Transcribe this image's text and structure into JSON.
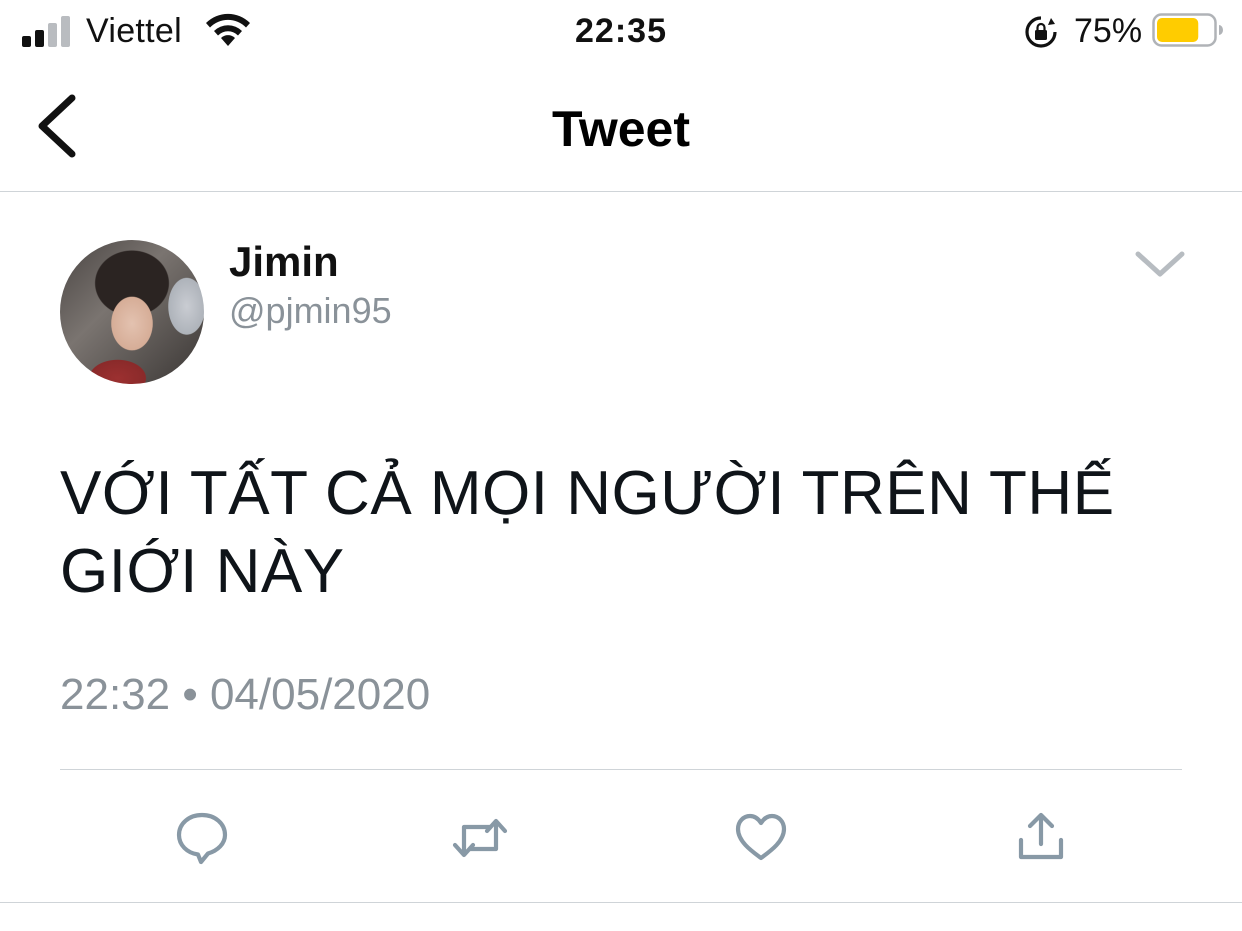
{
  "status_bar": {
    "carrier": "Viettel",
    "time": "22:35",
    "battery_percent": "75%",
    "battery_level": 0.75,
    "battery_color": "#ffcc00",
    "icons": [
      "signal-icon",
      "wifi-icon",
      "rotation-lock-icon",
      "battery-icon"
    ]
  },
  "nav": {
    "title": "Tweet",
    "back_icon": "chevron-left-icon"
  },
  "tweet": {
    "author": {
      "name": "Jimin",
      "handle": "@pjmin95"
    },
    "text": "VỚI TẤT CẢ MỌI NGƯỜI TRÊN THẾ GIỚI NÀY",
    "timestamp": "22:32 • 04/05/2020",
    "menu_icon": "chevron-down-icon"
  },
  "actions": [
    {
      "name": "reply",
      "icon": "reply-icon"
    },
    {
      "name": "retweet",
      "icon": "retweet-icon"
    },
    {
      "name": "like",
      "icon": "heart-icon"
    },
    {
      "name": "share",
      "icon": "share-icon"
    }
  ],
  "colors": {
    "text_primary": "#0f1419",
    "text_secondary": "#8a9299",
    "icon_gray": "#8899a6",
    "divider": "#cfd4d8"
  }
}
